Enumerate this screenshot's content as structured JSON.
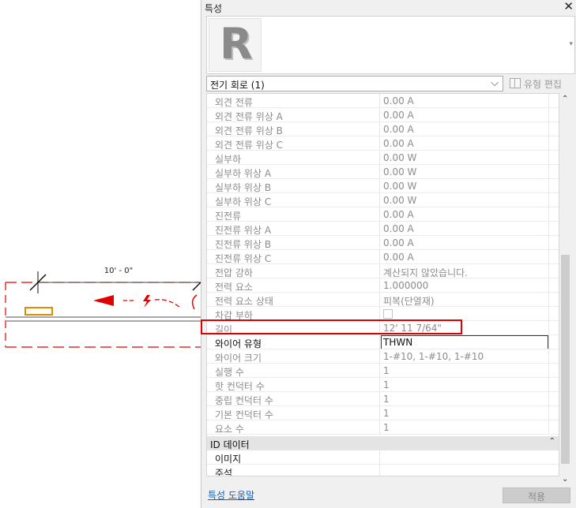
{
  "canvas": {
    "dimension_label": "10' - 0\""
  },
  "panel": {
    "title": "특성",
    "close_glyph": "✕",
    "type_selector": {
      "logo_letter": "R",
      "dropdown_glyph": "▾"
    },
    "instance": {
      "label": "전기 회로 (1)",
      "chevron": "⌵",
      "edit_type_label": "유형 편집"
    },
    "properties": [
      {
        "name": "외견 전류",
        "value": "0.00 A",
        "editable": false
      },
      {
        "name": "외견 전류 위상 A",
        "value": "0.00 A",
        "editable": false
      },
      {
        "name": "외견 전류 위상 B",
        "value": "0.00 A",
        "editable": false
      },
      {
        "name": "외견 전류 위상 C",
        "value": "0.00 A",
        "editable": false
      },
      {
        "name": "실부하",
        "value": "0.00 W",
        "editable": false
      },
      {
        "name": "실부하 위상 A",
        "value": "0.00 W",
        "editable": false
      },
      {
        "name": "실부하 위상 B",
        "value": "0.00 W",
        "editable": false
      },
      {
        "name": "실부하 위상 C",
        "value": "0.00 W",
        "editable": false
      },
      {
        "name": "진전류",
        "value": "0.00 A",
        "editable": false
      },
      {
        "name": "진전류 위상 A",
        "value": "0.00 A",
        "editable": false
      },
      {
        "name": "진전류 위상 B",
        "value": "0.00 A",
        "editable": false
      },
      {
        "name": "진전류 위상 C",
        "value": "0.00 A",
        "editable": false
      },
      {
        "name": "전압 강하",
        "value": "계산되지 않았습니다.",
        "editable": false
      },
      {
        "name": "전력 요소",
        "value": "1.000000",
        "editable": false
      },
      {
        "name": "전력 요소 상태",
        "value": "피복(단열재)",
        "editable": false
      },
      {
        "name": "차감 부하",
        "value": "",
        "editable": false,
        "checkbox": true
      },
      {
        "name": "길이",
        "value": "12'  11 7/64\"",
        "editable": false
      },
      {
        "name": "와이어 유형",
        "value": "THWN",
        "editable": true
      },
      {
        "name": "와이어 크기",
        "value": "1-#10, 1-#10, 1-#10",
        "editable": false
      },
      {
        "name": "실행 수",
        "value": "1",
        "editable": false
      },
      {
        "name": "핫 컨덕터 수",
        "value": "1",
        "editable": false
      },
      {
        "name": "중립 컨덕터 수",
        "value": "1",
        "editable": false
      },
      {
        "name": "기본 컨덕터 수",
        "value": "1",
        "editable": false
      },
      {
        "name": "요소 수",
        "value": "1",
        "editable": false
      }
    ],
    "group": {
      "name": "ID 데이터",
      "collapse_glyph": "⌃"
    },
    "group_properties": [
      {
        "name": "이미지",
        "value": ""
      },
      {
        "name": "주석",
        "value": ""
      }
    ],
    "scroll": {
      "up_glyph": "⌃",
      "down_glyph": "⌄"
    },
    "footer": {
      "help_link": "특성 도움말",
      "apply_label": "적용"
    }
  },
  "colors": {
    "highlight_border": "#e00000",
    "selection_red": "#e00000",
    "wire_gray": "#a8a8a8",
    "component_orange": "#e08a00"
  }
}
